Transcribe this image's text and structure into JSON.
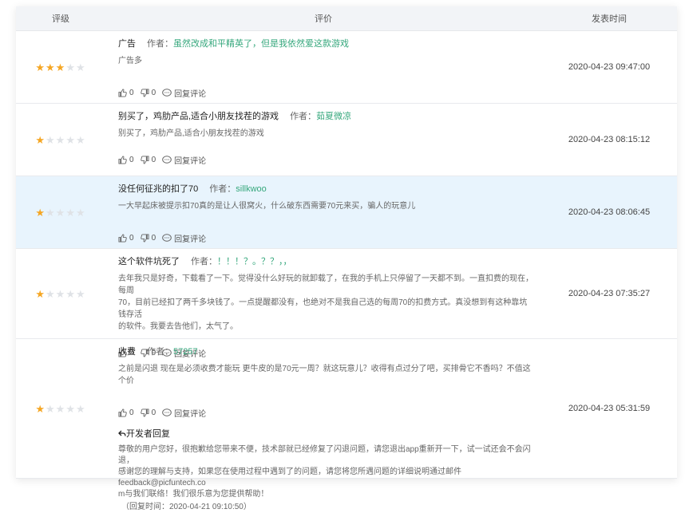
{
  "header": {
    "rating": "评级",
    "review": "评价",
    "time": "发表时间"
  },
  "reply_label": "回复评论",
  "author_label": "作者：",
  "dev_reply_label": "开发者回复",
  "reviews": [
    {
      "stars": 3,
      "title": "广告",
      "author": "虽然改成和平精英了，但是我依然爱这款游戏",
      "content": "广告多",
      "likes": "0",
      "dislikes": "0",
      "time": "2020-04-23 09:47:00"
    },
    {
      "stars": 1,
      "title": "别买了，鸡肋产品,适合小朋友找茬的游戏",
      "author": "茹夏微凉",
      "content": "别买了，鸡肋产品,适合小朋友找茬的游戏",
      "likes": "0",
      "dislikes": "0",
      "time": "2020-04-23 08:15:12"
    },
    {
      "stars": 1,
      "title": "没任何征兆的扣了70",
      "author": "sillkwoo",
      "content": "一大早起床被提示扣70真的是让人很窝火，什么破东西需要70元来买，骗人的玩意儿",
      "likes": "0",
      "dislikes": "0",
      "time": "2020-04-23 08:06:45"
    },
    {
      "stars": 1,
      "title": "这个软件坑死了",
      "author": "！！！？。？？，，",
      "content_lines": [
        "去年我只是好奇，下载看了一下。觉得没什么好玩的就卸载了，在我的手机上只停留了一天都不到。一直扣费的现在，每周",
        "70，目前已经扣了两千多块钱了。一点提醒都没有，也绝对不是我自己选的每周70的扣费方式。真没想到有这种靠坑钱存活",
        "的软件。我要去告他们，太气了。"
      ],
      "likes": "0",
      "dislikes": "0",
      "time": "2020-04-23 07:35:27"
    },
    {
      "stars": 1,
      "title": "收费",
      "author": "57257",
      "content": "之前是闪退 现在是必须收费才能玩 更牛皮的是70元一周？就这玩意儿？收得有点过分了吧，买排骨它不香吗？不值这个价",
      "likes": "0",
      "dislikes": "0",
      "time": "2020-04-23 05:31:59",
      "dev_reply_lines": [
        "尊敬的用户您好，很抱歉给您带来不便，技术部就已经修复了闪退问题，请您退出app重新开一下，试一试还会不会闪退，",
        "感谢您的理解与支持，如果您在使用过程中遇到了的问题，请您将您所遇问题的详细说明通过邮件feedback@picfuntech.co",
        "m与我们联络！我们很乐意为您提供帮助！"
      ],
      "dev_reply_time": "（回复时间：2020-04-21 09:10:50）"
    }
  ],
  "colors": {
    "star_on": "#f5a623",
    "star_off": "#dfe2e6",
    "author": "#35a77c",
    "highlight_row": "#e8f4fd"
  }
}
